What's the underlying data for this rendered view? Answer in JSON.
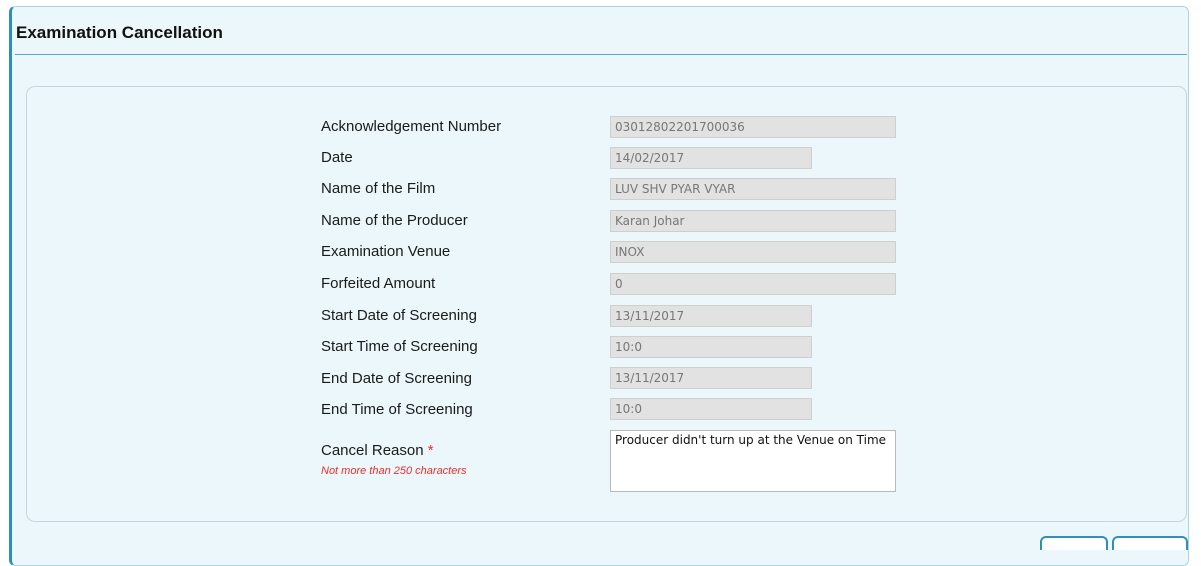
{
  "page": {
    "title": "Examination Cancellation"
  },
  "form": {
    "fields": [
      {
        "label": "Acknowledgement Number",
        "value": "03012802201700036"
      },
      {
        "label": "Date",
        "value": "14/02/2017"
      },
      {
        "label": "Name of the Film",
        "value": "LUV SHV PYAR VYAR"
      },
      {
        "label": "Name of the Producer",
        "value": "Karan Johar"
      },
      {
        "label": "Examination Venue",
        "value": "INOX"
      },
      {
        "label": "Forfeited Amount",
        "value": "0"
      },
      {
        "label": "Start Date of Screening",
        "value": "13/11/2017"
      },
      {
        "label": "Start Time of Screening",
        "value": "10:0"
      },
      {
        "label": "End Date of Screening",
        "value": "13/11/2017"
      },
      {
        "label": "End Time of Screening",
        "value": "10:0"
      }
    ],
    "cancel_reason": {
      "label": "Cancel Reason",
      "required_marker": "*",
      "hint": "Not more than 250 characters",
      "value": "Producer didn't turn up at the Venue on Time"
    }
  },
  "colors": {
    "panel_background": "#ecf7fb",
    "accent": "#2e8fb8",
    "required": "#e8302a",
    "readonly_field": "#e2e2e2"
  }
}
